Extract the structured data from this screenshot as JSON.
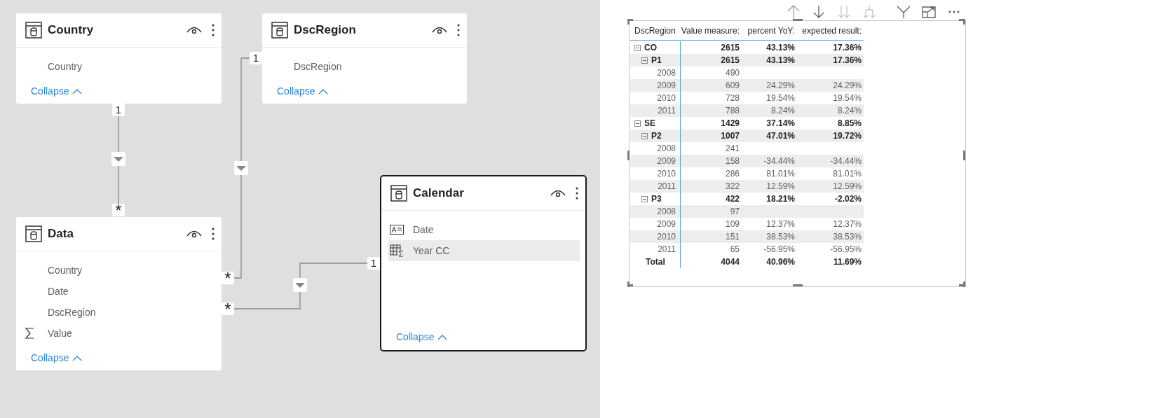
{
  "diagram": {
    "tables": [
      {
        "name": "Country",
        "selected": false,
        "fields": [
          {
            "name": "Country",
            "kind": "column",
            "selected": false
          }
        ],
        "collapse": "Collapse"
      },
      {
        "name": "DscRegion",
        "selected": false,
        "fields": [
          {
            "name": "DscRegion",
            "kind": "column",
            "selected": false
          }
        ],
        "collapse": "Collapse"
      },
      {
        "name": "Data",
        "selected": false,
        "fields": [
          {
            "name": "Country",
            "kind": "column",
            "selected": false
          },
          {
            "name": "Date",
            "kind": "column",
            "selected": false
          },
          {
            "name": "DscRegion",
            "kind": "column",
            "selected": false
          },
          {
            "name": "Value",
            "kind": "sum",
            "selected": false
          }
        ],
        "collapse": "Collapse"
      },
      {
        "name": "Calendar",
        "selected": true,
        "fields": [
          {
            "name": "Date",
            "kind": "key",
            "selected": false
          },
          {
            "name": "Year CC",
            "kind": "calculated",
            "selected": true
          }
        ],
        "collapse": "Collapse"
      }
    ],
    "relationships": [
      {
        "one": "1",
        "many": "*"
      },
      {
        "one": "1",
        "many": "*"
      },
      {
        "one": "1",
        "many": "*"
      }
    ]
  },
  "visual": {
    "toolbar": [
      {
        "kind": "drill_up",
        "disabled": false
      },
      {
        "kind": "drill_down",
        "disabled": false
      },
      {
        "kind": "next_level",
        "disabled": true
      },
      {
        "kind": "expand_all",
        "disabled": true
      },
      {
        "kind": "filter",
        "disabled": false
      },
      {
        "kind": "focus",
        "disabled": false
      },
      {
        "kind": "more",
        "disabled": false
      }
    ],
    "matrix": {
      "columns": [
        "DscRegion",
        "Value measure:",
        "percent YoY:",
        "expected result:"
      ],
      "rows": [
        {
          "label": "CO",
          "value_measure": "2615",
          "percent_yoy": "43.13%",
          "expected_result": "17.36%",
          "expanded": true,
          "children": [
            {
              "label": "P1",
              "value_measure": "2615",
              "percent_yoy": "43.13%",
              "expected_result": "17.36%",
              "expanded": true,
              "children": [
                {
                  "label": "2008",
                  "value_measure": "490"
                },
                {
                  "label": "2009",
                  "value_measure": "609",
                  "percent_yoy": "24.29%",
                  "expected_result": "24.29%"
                },
                {
                  "label": "2010",
                  "value_measure": "728",
                  "percent_yoy": "19.54%",
                  "expected_result": "19.54%"
                },
                {
                  "label": "2011",
                  "value_measure": "788",
                  "percent_yoy": "8.24%",
                  "expected_result": "8.24%"
                }
              ]
            }
          ]
        },
        {
          "label": "SE",
          "value_measure": "1429",
          "percent_yoy": "37.14%",
          "expected_result": "8.85%",
          "expanded": true,
          "children": [
            {
              "label": "P2",
              "value_measure": "1007",
              "percent_yoy": "47.01%",
              "expected_result": "19.72%",
              "expanded": true,
              "children": [
                {
                  "label": "2008",
                  "value_measure": "241"
                },
                {
                  "label": "2009",
                  "value_measure": "158",
                  "percent_yoy": "-34.44%",
                  "expected_result": "-34.44%"
                },
                {
                  "label": "2010",
                  "value_measure": "286",
                  "percent_yoy": "81.01%",
                  "expected_result": "81.01%"
                },
                {
                  "label": "2011",
                  "value_measure": "322",
                  "percent_yoy": "12.59%",
                  "expected_result": "12.59%"
                }
              ]
            },
            {
              "label": "P3",
              "value_measure": "422",
              "percent_yoy": "18.21%",
              "expected_result": "-2.02%",
              "expanded": true,
              "children": [
                {
                  "label": "2008",
                  "value_measure": "97"
                },
                {
                  "label": "2009",
                  "value_measure": "109",
                  "percent_yoy": "12.37%",
                  "expected_result": "12.37%"
                },
                {
                  "label": "2010",
                  "value_measure": "151",
                  "percent_yoy": "38.53%",
                  "expected_result": "38.53%"
                },
                {
                  "label": "2011",
                  "value_measure": "65",
                  "percent_yoy": "-56.95%",
                  "expected_result": "-56.95%"
                }
              ]
            }
          ]
        }
      ],
      "total": {
        "label": "Total",
        "value_measure": "4044",
        "percent_yoy": "40.96%",
        "expected_result": "11.69%"
      }
    }
  }
}
